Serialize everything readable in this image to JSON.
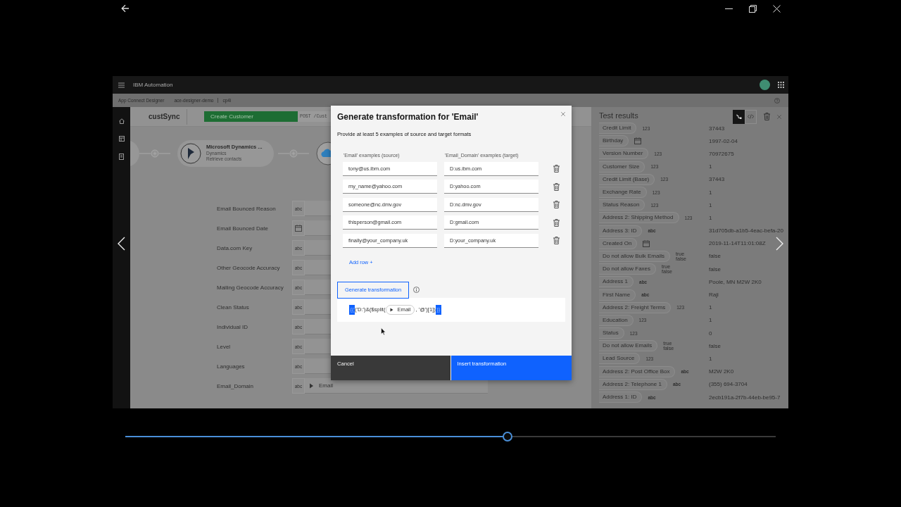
{
  "player": {
    "seek": {
      "level": 0.588
    }
  },
  "app": {
    "brand": "IBM Automation",
    "breadcrumb": [
      "App Connect Designer",
      "ace-designer-demo",
      "cp4i"
    ]
  },
  "flow": {
    "name": "custSync",
    "operation": "Create Customer",
    "path": "POST /Cust"
  },
  "nodes": [
    {
      "title": "Microsoft Dynamics ...",
      "app": "Dynamics",
      "action": "Retrieve contacts"
    }
  ],
  "fields": [
    {
      "label": "Email Bounced Reason",
      "kind": "text",
      "type": "abc"
    },
    {
      "label": "Email Bounced Date",
      "kind": "date"
    },
    {
      "label": "Data.com Key",
      "kind": "text",
      "type": "abc"
    },
    {
      "label": "Other Geocode Accuracy",
      "kind": "text",
      "type": "abc"
    },
    {
      "label": "Mailing Geocode Accuracy",
      "kind": "text",
      "type": "abc"
    },
    {
      "label": "Clean Status",
      "kind": "text",
      "type": "abc"
    },
    {
      "label": "Individual ID",
      "kind": "text",
      "type": "abc"
    },
    {
      "label": "Level",
      "kind": "text",
      "type": "abc"
    },
    {
      "label": "Languages",
      "kind": "text",
      "type": "abc"
    },
    {
      "label": "Email_Domain",
      "kind": "text",
      "type": "abc",
      "mapping": "Email"
    }
  ],
  "modal": {
    "title": "Generate transformation for 'Email'",
    "subtitle": "Provide at least 5 examples of source and target formats",
    "source_header": "'Email' examples (source)",
    "target_header": "'Email_Domain' examples (target)",
    "examples": [
      {
        "source": "tony@us.ibm.com",
        "target": "D:us.ibm.com"
      },
      {
        "source": "my_name@yahoo.com",
        "target": "D:yahoo.com"
      },
      {
        "source": "someone@nc.dmv.gov",
        "target": "D:nc.dmv.gov"
      },
      {
        "source": "thisperson@gmail.com",
        "target": "D:gmail.com"
      },
      {
        "source": "finally@your_company.uk",
        "target": "D:your_company.uk"
      }
    ],
    "add_row": "Add row +",
    "generate": "Generate transformation",
    "expression": {
      "open": "{{",
      "before": "('D:')&($split(",
      "chip": "Email",
      "after": ", '@')[1])",
      "close": "}}"
    },
    "cancel": "Cancel",
    "insert": "Insert transformation"
  },
  "test_results": {
    "title": "Test results",
    "views": [
      {
        "kind": "tree",
        "selected": true
      },
      {
        "kind": "code",
        "selected": false
      }
    ],
    "rows": [
      {
        "label": "Credit Limit",
        "kind": "number",
        "type": "123",
        "value": "37443"
      },
      {
        "label": "Birthday",
        "kind": "date",
        "value": "1997-02-04"
      },
      {
        "label": "Version Number",
        "kind": "number",
        "type": "123",
        "value": "70972675"
      },
      {
        "label": "Customer Size",
        "kind": "number",
        "type": "123",
        "value": "1"
      },
      {
        "label": "Credit Limit (Base)",
        "kind": "number",
        "type": "123",
        "value": "37443"
      },
      {
        "label": "Exchange Rate",
        "kind": "number",
        "type": "123",
        "value": "1"
      },
      {
        "label": "Status Reason",
        "kind": "number",
        "type": "123",
        "value": "1"
      },
      {
        "label": "Address 2: Shipping Method",
        "kind": "number",
        "type": "123",
        "value": "1"
      },
      {
        "label": "Address 3: ID",
        "kind": "text",
        "type": "abc",
        "value": "31d705db-a1b5-4eac-befa-20"
      },
      {
        "label": "Created On",
        "kind": "date",
        "value": "2019-11-14T11:01:08Z"
      },
      {
        "label": "Do not allow Bulk Emails",
        "kind": "boolean",
        "type": "true false",
        "value": "false"
      },
      {
        "label": "Do not allow Faxes",
        "kind": "boolean",
        "type": "true false",
        "value": "false"
      },
      {
        "label": "Address 1",
        "kind": "text",
        "type": "abc",
        "value": "Poole, MN M2W 2K0"
      },
      {
        "label": "First Name",
        "kind": "text",
        "type": "abc",
        "value": "Raji"
      },
      {
        "label": "Address 2: Freight Terms",
        "kind": "number",
        "type": "123",
        "value": "1"
      },
      {
        "label": "Education",
        "kind": "number",
        "type": "123",
        "value": "1"
      },
      {
        "label": "Status",
        "kind": "number",
        "type": "123",
        "value": "0"
      },
      {
        "label": "Do not allow Emails",
        "kind": "boolean",
        "type": "true false",
        "value": "false"
      },
      {
        "label": "Lead Source",
        "kind": "number",
        "type": "123",
        "value": "1"
      },
      {
        "label": "Address 2: Post Office Box",
        "kind": "text",
        "type": "abc",
        "value": "M2W 2K0"
      },
      {
        "label": "Address 2: Telephone 1",
        "kind": "text",
        "type": "abc",
        "value": "(355) 694-3704"
      },
      {
        "label": "Address 1: ID",
        "kind": "text",
        "type": "abc",
        "value": "2ecb191a-2f7b-44eb-be95-7"
      }
    ]
  }
}
